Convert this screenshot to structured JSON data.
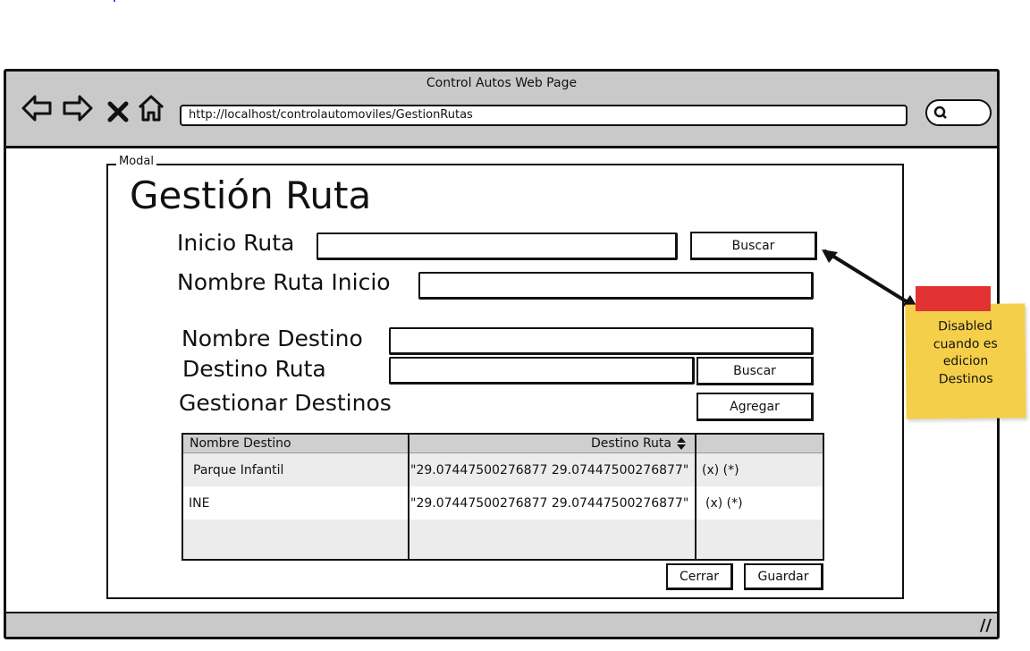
{
  "window": {
    "title": "Control Autos Web Page",
    "url": "http://localhost/controlautomoviles/GestionRutas",
    "nav_icons": [
      "back-arrow-icon",
      "forward-arrow-icon",
      "close-x-icon",
      "home-icon"
    ],
    "search_icon": "search-icon",
    "resize_glyph": "//"
  },
  "modal": {
    "legend": "Modal",
    "title": "Gestión Ruta",
    "inicio_ruta": {
      "label": "Inicio Ruta",
      "value": "",
      "button": "Buscar"
    },
    "nombre_ruta_inicio": {
      "label": "Nombre Ruta Inicio",
      "value": ""
    },
    "nombre_destino": {
      "label": "Nombre Destino",
      "value": ""
    },
    "destino_ruta": {
      "label": "Destino Ruta",
      "value": "",
      "button": "Buscar"
    },
    "gestionar_destinos": {
      "label": "Gestionar Destinos",
      "button": "Agregar"
    },
    "table": {
      "columns": [
        "Nombre Destino",
        "Destino Ruta"
      ],
      "sort_icon": "sort-updown-icon",
      "rows": [
        {
          "nombre": "Parque Infantil",
          "destino": "\"29.07447500276877 29.07447500276877\"",
          "actions": "(x) (*)"
        },
        {
          "nombre": "INE",
          "destino": "\"29.07447500276877 29.07447500276877\"",
          "actions": "(x) (*)"
        }
      ]
    },
    "buttons": {
      "cerrar": "Cerrar",
      "guardar": "Guardar"
    }
  },
  "note": {
    "text": [
      "Disabled",
      "cuando es",
      "edicion",
      "Destinos"
    ],
    "color": "#f5cf4a",
    "tape_color": "#e23232"
  },
  "colors": {
    "chrome": "#c9c9c9",
    "table_header": "#cfcfcf",
    "row_alt": "#ececec"
  }
}
